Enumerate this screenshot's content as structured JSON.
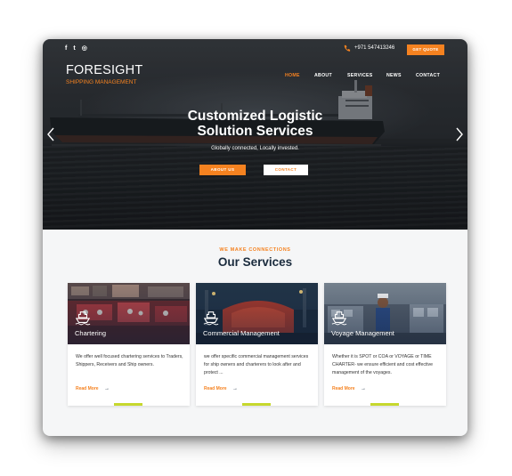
{
  "topbar": {
    "social": [
      {
        "icon": "facebook-icon",
        "glyph": "f"
      },
      {
        "icon": "twitter-icon",
        "glyph": "t"
      },
      {
        "icon": "instagram-icon",
        "glyph": "◎"
      }
    ],
    "phone_icon": "phone-icon",
    "phone": "+971 547413246",
    "quote_label": "GET QUOTE"
  },
  "brand": {
    "name": "FORESIGHT",
    "tagline": "SHIPPING MANAGEMENT"
  },
  "nav": [
    {
      "label": "HOME",
      "active": true
    },
    {
      "label": "ABOUT",
      "active": false
    },
    {
      "label": "SERVICES",
      "active": false
    },
    {
      "label": "NEWS",
      "active": false
    },
    {
      "label": "CONTACT",
      "active": false
    }
  ],
  "hero": {
    "title_line1": "Customized Logistic",
    "title_line2": "Solution Services",
    "subtitle": "Globally connected, Locally invested.",
    "about_label": "ABOUT US",
    "contact_label": "CONTACT",
    "prev_icon": "chevron-left-icon",
    "next_icon": "chevron-right-icon"
  },
  "services": {
    "kicker": "WE MAKE CONNECTIONS",
    "heading": "Our Services",
    "cards": [
      {
        "title": "Chartering",
        "icon": "ship-icon",
        "text": "We offer well focused chartering services to Traders, Shippers, Receivers and Ship owners.",
        "link": "Read More",
        "arrow": "→"
      },
      {
        "title": "Commercial Management",
        "icon": "ship-icon",
        "text": "we offer specific commercial management services for ship owners and charterers to look after and protect ...",
        "link": "Read More",
        "arrow": "→"
      },
      {
        "title": "Voyage Management",
        "icon": "ship-icon",
        "text": "Whether it is SPOT or COA or VOYAGE or TIME CHARTER- we ensure efficient and cost effective management of the voyages.",
        "link": "Read More",
        "arrow": "→"
      }
    ]
  },
  "colors": {
    "accent": "#f58220",
    "heading": "#1a2b3d",
    "card_bar": "#c6d82e"
  }
}
